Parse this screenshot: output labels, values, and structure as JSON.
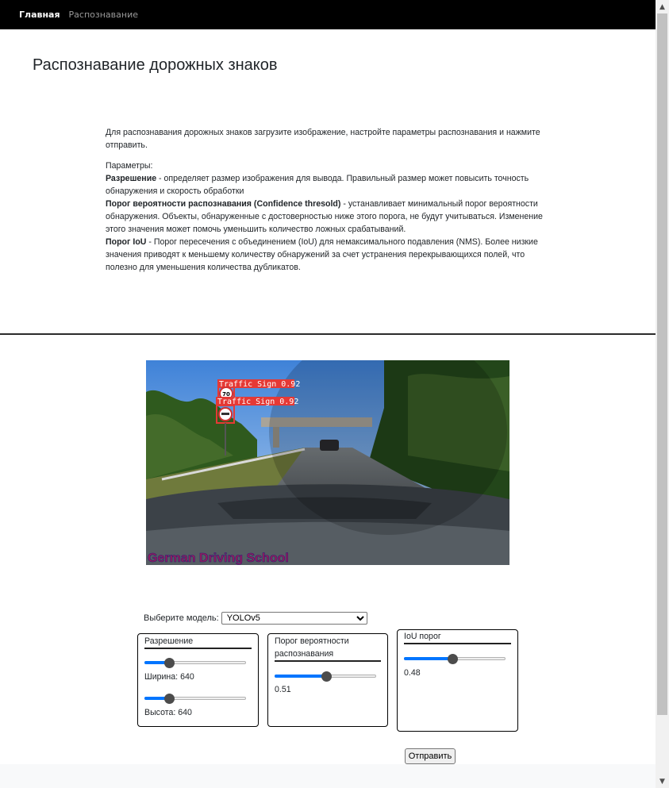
{
  "nav": {
    "home": "Главная",
    "recognition": "Распознавание"
  },
  "page_title": "Распознавание дорожных знаков",
  "intro": {
    "lead": "Для распознавания дорожных знаков загрузите изображение, настройте параметры распознавания и нажмите отправить.",
    "params_label": "Параметры:",
    "resolution_term": "Разрешение",
    "resolution_desc": " - определяет размер изображения для вывода. Правильный размер может повысить точность обнаружения и скорость обработки",
    "confidence_term": "Порог вероятности распознавания (Confidence thresold)",
    "confidence_desc": " - устанавливает минимальный порог вероятности обнаружения. Объекты, обнаруженные с достоверностью ниже этого порога, не будут учитываться. Изменение этого значения может помочь уменьшить количество ложных срабатываний.",
    "iou_term": "Порог IoU",
    "iou_desc": " - Порог пересечения с объединением (IoU) для немаксимального подавления (NMS). Более низкие значения приводят к меньшему количеству обнаружений за счет устранения перекрывающихся полей, что полезно для уменьшения количества дубликатов."
  },
  "image": {
    "detections": [
      {
        "label": "Traffic Sign 0.92",
        "sign": "70"
      },
      {
        "label": "Traffic Sign 0.92",
        "sign": "no-overtaking"
      }
    ],
    "watermark": "German Driving School"
  },
  "model": {
    "label": "Выберите модель:",
    "selected": "YOLOv5"
  },
  "resolution_panel": {
    "title": "Разрешение",
    "width_label": "Ширина: 640",
    "height_label": "Высота: 640",
    "width_fraction": 0.24,
    "height_fraction": 0.24
  },
  "confidence_panel": {
    "title": "Порог вероятности распознавания",
    "value": "0.51",
    "fraction": 0.51
  },
  "iou_panel": {
    "title": "IoU порог",
    "value": "0.48",
    "fraction": 0.48
  },
  "submit_label": "Отправить",
  "colors": {
    "navbar": "#000000",
    "accent": "#0075ff",
    "detection_box": "#e53935"
  }
}
